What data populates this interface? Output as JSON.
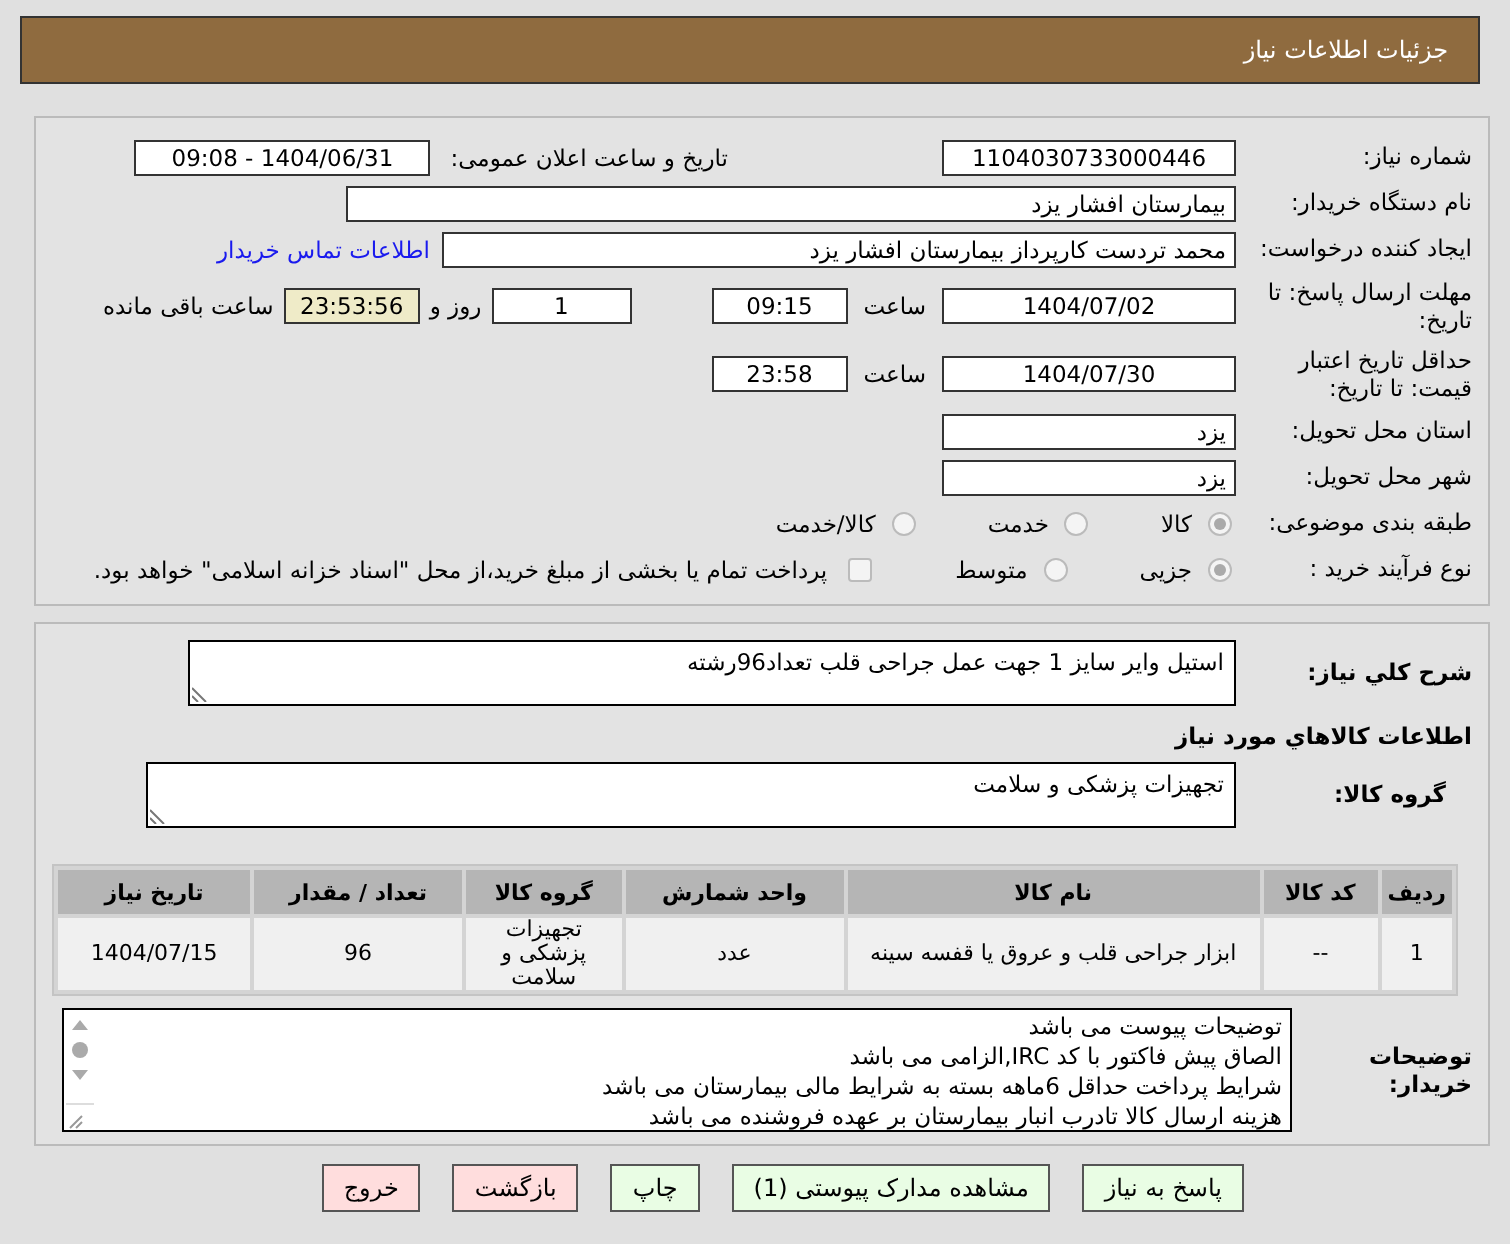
{
  "header": {
    "title": "جزئیات اطلاعات نیاز"
  },
  "need_number": {
    "label": "شماره نیاز:",
    "value": "1104030733000446"
  },
  "announce": {
    "label": "تاریخ و ساعت اعلان عمومی:",
    "value": "1404/06/31 - 09:08"
  },
  "buyer": {
    "label": "نام دستگاه خریدار:",
    "value": "بیمارستان افشار یزد"
  },
  "creator": {
    "label": "ایجاد کننده درخواست:",
    "value": "محمد تردست کارپرداز بیمارستان افشار یزد",
    "link": "اطلاعات تماس خریدار"
  },
  "deadline": {
    "label": "مهلت ارسال پاسخ: تا تاریخ:",
    "date": "1404/07/02",
    "time_label": "ساعت",
    "time": "09:15",
    "days": "1",
    "days_label": "روز و",
    "remaining": "23:53:56",
    "remaining_label": "ساعت باقی مانده"
  },
  "validity": {
    "label": "حداقل تاریخ اعتبار قیمت: تا تاریخ:",
    "date": "1404/07/30",
    "time_label": "ساعت",
    "time": "23:58"
  },
  "province": {
    "label": "استان محل تحویل:",
    "value": "یزد"
  },
  "city": {
    "label": "شهر محل تحویل:",
    "value": "یزد"
  },
  "category": {
    "label": "طبقه بندی موضوعی:",
    "options": [
      {
        "label": "کالا",
        "selected": true
      },
      {
        "label": "خدمت",
        "selected": false
      },
      {
        "label": "کالا/خدمت",
        "selected": false
      }
    ]
  },
  "process": {
    "label": "نوع فرآیند خرید :",
    "options": [
      {
        "label": "جزیی",
        "selected": true
      },
      {
        "label": "متوسط",
        "selected": false
      }
    ],
    "payment": {
      "checked": false,
      "text": "پرداخت تمام یا بخشی از مبلغ خرید،از محل \"اسناد خزانه اسلامی\" خواهد بود."
    }
  },
  "description": {
    "label": "شرح کلي نیاز:",
    "value": "استیل وایر سایز 1 جهت عمل جراحی قلب تعداد96رشته"
  },
  "goods_heading": "اطلاعات کالاهاي مورد نیاز",
  "goods_group": {
    "label": "گروه کالا:",
    "value": "تجهیزات پزشکی و سلامت"
  },
  "table": {
    "columns": [
      "ردیف",
      "کد کالا",
      "نام کالا",
      "واحد شمارش",
      "گروه کالا",
      "تعداد / مقدار",
      "تاریخ نیاز"
    ],
    "rows": [
      [
        "1",
        "--",
        "ابزار جراحی قلب و عروق یا قفسه سینه",
        "عدد",
        "تجهیزات پزشکی و سلامت",
        "96",
        "1404/07/15"
      ]
    ]
  },
  "buyer_notes": {
    "label": "توضیحات خریدار:",
    "lines": [
      "توضیحات پیوست می باشد",
      "الصاق پیش فاکتور با کد  IRC,الزامی می باشد",
      "شرایط پرداخت حداقل 6ماهه بسته به شرایط مالی بیمارستان می باشد",
      "هزینه ارسال کالا تادرب انبار بیمارستان بر عهده فروشنده می باشد"
    ]
  },
  "buttons": [
    {
      "label": "پاسخ به نیاز",
      "kind": "primary"
    },
    {
      "label": "مشاهده مدارک پیوستی (1)",
      "kind": "primary"
    },
    {
      "label": "چاپ",
      "kind": "primary"
    },
    {
      "label": "بازگشت",
      "kind": "danger"
    },
    {
      "label": "خروج",
      "kind": "danger"
    }
  ]
}
